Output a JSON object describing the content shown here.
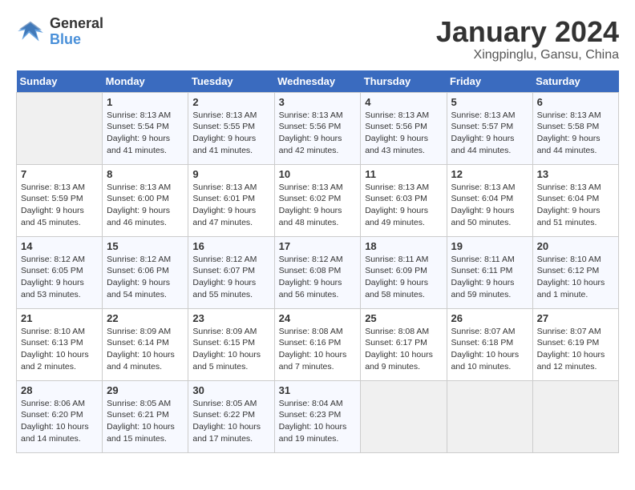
{
  "logo": {
    "line1": "General",
    "line2": "Blue"
  },
  "title": "January 2024",
  "location": "Xingpinglu, Gansu, China",
  "weekdays": [
    "Sunday",
    "Monday",
    "Tuesday",
    "Wednesday",
    "Thursday",
    "Friday",
    "Saturday"
  ],
  "weeks": [
    [
      {
        "day": "",
        "info": ""
      },
      {
        "day": "1",
        "info": "Sunrise: 8:13 AM\nSunset: 5:54 PM\nDaylight: 9 hours\nand 41 minutes."
      },
      {
        "day": "2",
        "info": "Sunrise: 8:13 AM\nSunset: 5:55 PM\nDaylight: 9 hours\nand 41 minutes."
      },
      {
        "day": "3",
        "info": "Sunrise: 8:13 AM\nSunset: 5:56 PM\nDaylight: 9 hours\nand 42 minutes."
      },
      {
        "day": "4",
        "info": "Sunrise: 8:13 AM\nSunset: 5:56 PM\nDaylight: 9 hours\nand 43 minutes."
      },
      {
        "day": "5",
        "info": "Sunrise: 8:13 AM\nSunset: 5:57 PM\nDaylight: 9 hours\nand 44 minutes."
      },
      {
        "day": "6",
        "info": "Sunrise: 8:13 AM\nSunset: 5:58 PM\nDaylight: 9 hours\nand 44 minutes."
      }
    ],
    [
      {
        "day": "7",
        "info": "Sunrise: 8:13 AM\nSunset: 5:59 PM\nDaylight: 9 hours\nand 45 minutes."
      },
      {
        "day": "8",
        "info": "Sunrise: 8:13 AM\nSunset: 6:00 PM\nDaylight: 9 hours\nand 46 minutes."
      },
      {
        "day": "9",
        "info": "Sunrise: 8:13 AM\nSunset: 6:01 PM\nDaylight: 9 hours\nand 47 minutes."
      },
      {
        "day": "10",
        "info": "Sunrise: 8:13 AM\nSunset: 6:02 PM\nDaylight: 9 hours\nand 48 minutes."
      },
      {
        "day": "11",
        "info": "Sunrise: 8:13 AM\nSunset: 6:03 PM\nDaylight: 9 hours\nand 49 minutes."
      },
      {
        "day": "12",
        "info": "Sunrise: 8:13 AM\nSunset: 6:04 PM\nDaylight: 9 hours\nand 50 minutes."
      },
      {
        "day": "13",
        "info": "Sunrise: 8:13 AM\nSunset: 6:04 PM\nDaylight: 9 hours\nand 51 minutes."
      }
    ],
    [
      {
        "day": "14",
        "info": "Sunrise: 8:12 AM\nSunset: 6:05 PM\nDaylight: 9 hours\nand 53 minutes."
      },
      {
        "day": "15",
        "info": "Sunrise: 8:12 AM\nSunset: 6:06 PM\nDaylight: 9 hours\nand 54 minutes."
      },
      {
        "day": "16",
        "info": "Sunrise: 8:12 AM\nSunset: 6:07 PM\nDaylight: 9 hours\nand 55 minutes."
      },
      {
        "day": "17",
        "info": "Sunrise: 8:12 AM\nSunset: 6:08 PM\nDaylight: 9 hours\nand 56 minutes."
      },
      {
        "day": "18",
        "info": "Sunrise: 8:11 AM\nSunset: 6:09 PM\nDaylight: 9 hours\nand 58 minutes."
      },
      {
        "day": "19",
        "info": "Sunrise: 8:11 AM\nSunset: 6:11 PM\nDaylight: 9 hours\nand 59 minutes."
      },
      {
        "day": "20",
        "info": "Sunrise: 8:10 AM\nSunset: 6:12 PM\nDaylight: 10 hours\nand 1 minute."
      }
    ],
    [
      {
        "day": "21",
        "info": "Sunrise: 8:10 AM\nSunset: 6:13 PM\nDaylight: 10 hours\nand 2 minutes."
      },
      {
        "day": "22",
        "info": "Sunrise: 8:09 AM\nSunset: 6:14 PM\nDaylight: 10 hours\nand 4 minutes."
      },
      {
        "day": "23",
        "info": "Sunrise: 8:09 AM\nSunset: 6:15 PM\nDaylight: 10 hours\nand 5 minutes."
      },
      {
        "day": "24",
        "info": "Sunrise: 8:08 AM\nSunset: 6:16 PM\nDaylight: 10 hours\nand 7 minutes."
      },
      {
        "day": "25",
        "info": "Sunrise: 8:08 AM\nSunset: 6:17 PM\nDaylight: 10 hours\nand 9 minutes."
      },
      {
        "day": "26",
        "info": "Sunrise: 8:07 AM\nSunset: 6:18 PM\nDaylight: 10 hours\nand 10 minutes."
      },
      {
        "day": "27",
        "info": "Sunrise: 8:07 AM\nSunset: 6:19 PM\nDaylight: 10 hours\nand 12 minutes."
      }
    ],
    [
      {
        "day": "28",
        "info": "Sunrise: 8:06 AM\nSunset: 6:20 PM\nDaylight: 10 hours\nand 14 minutes."
      },
      {
        "day": "29",
        "info": "Sunrise: 8:05 AM\nSunset: 6:21 PM\nDaylight: 10 hours\nand 15 minutes."
      },
      {
        "day": "30",
        "info": "Sunrise: 8:05 AM\nSunset: 6:22 PM\nDaylight: 10 hours\nand 17 minutes."
      },
      {
        "day": "31",
        "info": "Sunrise: 8:04 AM\nSunset: 6:23 PM\nDaylight: 10 hours\nand 19 minutes."
      },
      {
        "day": "",
        "info": ""
      },
      {
        "day": "",
        "info": ""
      },
      {
        "day": "",
        "info": ""
      }
    ]
  ]
}
